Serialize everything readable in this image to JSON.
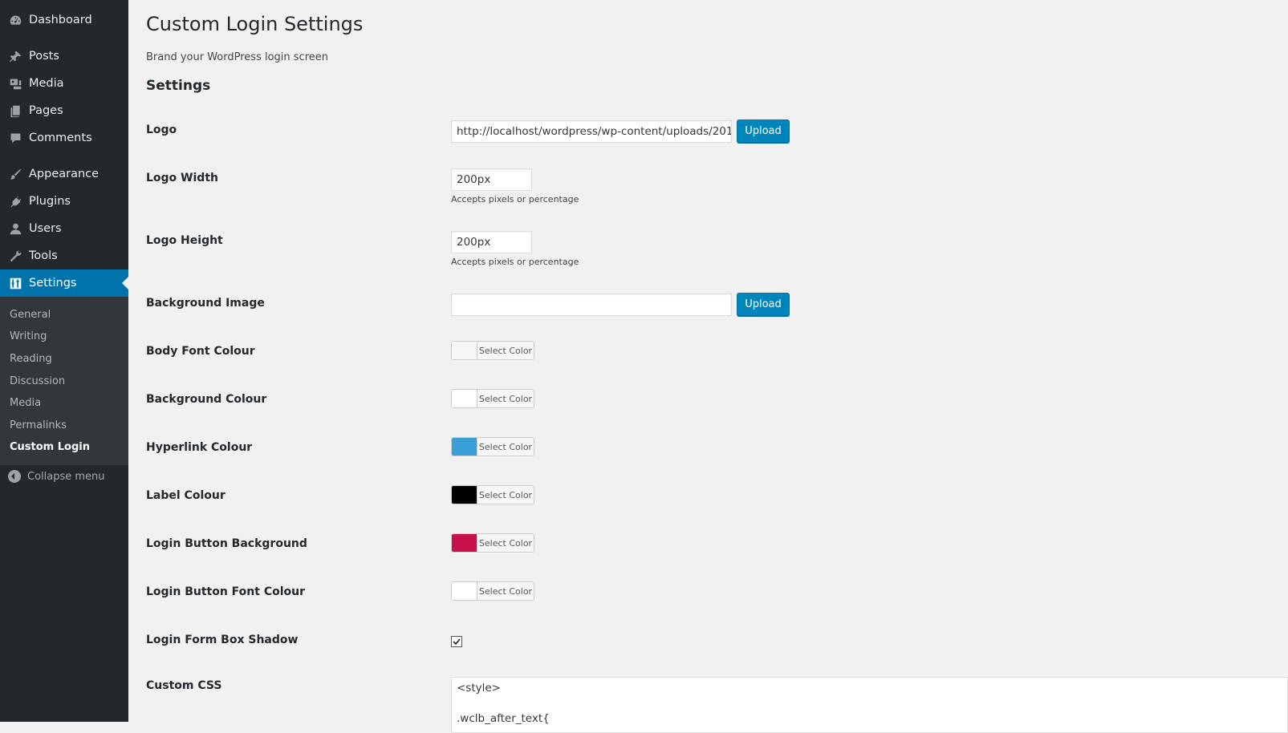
{
  "sidebar": {
    "items": [
      {
        "label": "Dashboard",
        "icon": "dashboard-icon"
      },
      {
        "label": "Posts",
        "icon": "pin-icon"
      },
      {
        "label": "Media",
        "icon": "media-icon"
      },
      {
        "label": "Pages",
        "icon": "pages-icon"
      },
      {
        "label": "Comments",
        "icon": "comment-icon"
      },
      {
        "label": "Appearance",
        "icon": "brush-icon"
      },
      {
        "label": "Plugins",
        "icon": "plug-icon"
      },
      {
        "label": "Users",
        "icon": "user-icon"
      },
      {
        "label": "Tools",
        "icon": "wrench-icon"
      },
      {
        "label": "Settings",
        "icon": "settings-icon"
      }
    ],
    "submenu": [
      "General",
      "Writing",
      "Reading",
      "Discussion",
      "Media",
      "Permalinks",
      "Custom Login"
    ],
    "collapse_label": "Collapse menu"
  },
  "page": {
    "title": "Custom Login Settings",
    "description": "Brand your WordPress login screen",
    "section_title": "Settings"
  },
  "fields": {
    "logo": {
      "label": "Logo",
      "value": "http://localhost/wordpress/wp-content/uploads/201",
      "button": "Upload"
    },
    "logo_width": {
      "label": "Logo Width",
      "value": "200px",
      "hint": "Accepts pixels or percentage"
    },
    "logo_height": {
      "label": "Logo Height",
      "value": "200px",
      "hint": "Accepts pixels or percentage"
    },
    "background_image": {
      "label": "Background Image",
      "value": "",
      "button": "Upload"
    },
    "body_font_colour": {
      "label": "Body Font Colour",
      "button": "Select Color",
      "color": "#f7f7f7"
    },
    "background_colour": {
      "label": "Background Colour",
      "button": "Select Color",
      "color": "#ffffff"
    },
    "hyperlink_colour": {
      "label": "Hyperlink Colour",
      "button": "Select Color",
      "color": "#3a9fd6"
    },
    "label_colour": {
      "label": "Label Colour",
      "button": "Select Color",
      "color": "#000000"
    },
    "login_button_background": {
      "label": "Login Button Background",
      "button": "Select Color",
      "color": "#c8104a"
    },
    "login_button_font_colour": {
      "label": "Login Button Font Colour",
      "button": "Select Color",
      "color": "#ffffff"
    },
    "login_form_box_shadow": {
      "label": "Login Form Box Shadow",
      "checked": true
    },
    "custom_css": {
      "label": "Custom CSS",
      "lines": [
        "<style>",
        "",
        ".wclb_after_text{"
      ]
    }
  }
}
